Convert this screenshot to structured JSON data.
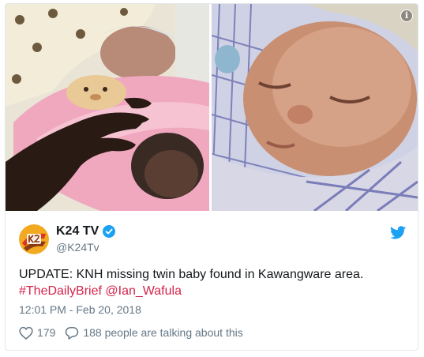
{
  "tweet": {
    "display_name": "K24 TV",
    "handle": "@K24Tv",
    "text_main": "UPDATE: KNH missing twin baby found in Kawangware area.",
    "hashtag": "#TheDailyBrief",
    "mention": "@Ian_Wafula",
    "timestamp": "12:01 PM - Feb 20, 2018",
    "likes_count": "179",
    "talking_text": "188 people are talking about this",
    "info_glyph": "i"
  },
  "icons": {
    "info": "info-icon",
    "verified": "verified-badge-icon",
    "bird": "twitter-bird-icon",
    "heart": "heart-icon",
    "reply": "speech-bubble-icon"
  },
  "colors": {
    "link": "#d6244c",
    "twitter_blue": "#1da1f2",
    "secondary_text": "#657786",
    "border": "#e1e8ed"
  }
}
